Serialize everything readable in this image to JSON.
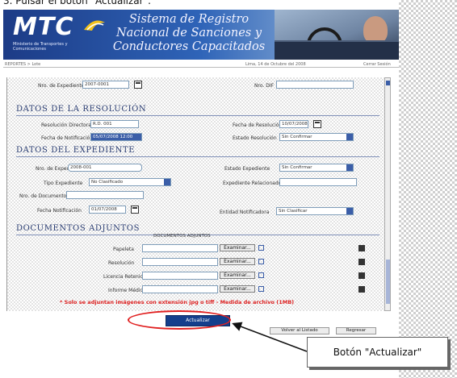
{
  "caption": "3. Pulsar el botón \"Actualizar\".",
  "banner": {
    "logo": "MTC",
    "logo_sub": "Ministerio de Transportes y Comunicaciones",
    "title_lines": [
      "Sistema de Registro",
      "Nacional de Sanciones y",
      "Conductores Capacitados"
    ]
  },
  "infobar": {
    "left": "REPORTES > Lote",
    "middle": "Lima, 14 de Octubre del 2008",
    "right": "Cerrar Sesión"
  },
  "top_row": {
    "fecha_label": "Nro. de Expediente",
    "fecha_value": "2007-0001",
    "ruc_label": "Nro. DIF",
    "ruc_value": ""
  },
  "resolucion": {
    "title": "DATOS DE LA RESOLUCIÓN",
    "nro_label": "Resolución Directoral",
    "nro_value": "R.D. 001",
    "fecha_label": "Fecha de Resolución",
    "fecha_value": "10/07/2008",
    "notif_label": "Fecha de Notificación",
    "notif_value": "05/07/2008 12:00",
    "estado_label": "Estado Resolución",
    "estado_value": "Sin Confirmar"
  },
  "expediente": {
    "title": "DATOS DEL EXPEDIENTE",
    "nro_label": "Nro. de Expediente",
    "nro_value": "2008-001",
    "estado_label": "Estado Expediente",
    "estado_value": "Sin Confirmar",
    "tipo_label": "Tipo Expediente",
    "tipo_value": "No Clasificado",
    "exp_label": "Expediente Relacionado",
    "exp_value": "",
    "doc_label": "Nro. de Documento Rel.",
    "doc_value": "",
    "fecha_label": "Fecha Notificación",
    "fecha_value": "01/07/2008",
    "entidad_label": "Entidad Notificadora",
    "entidad_value": "Sin Clasificar"
  },
  "documentos": {
    "title": "DOCUMENTOS ADJUNTOS",
    "subtitle": "DOCUMENTOS ADJUNTOS",
    "rows": [
      "Papeleta",
      "Resolución",
      "Licencia Retenida",
      "Informe Médico"
    ],
    "button_label": "Examinar..."
  },
  "notice": "* Solo se adjuntan imágenes con extensión jpg o tiff - Medida de archivo (1MB)",
  "buttons": {
    "actualizar": "Actualizar",
    "small_left": "Volver al Listado",
    "small_right": "Regresar"
  },
  "callout": "Botón \"Actualizar\"",
  "colors": {
    "accent": "#143f8c",
    "highlight": "#e02020",
    "notice": "#dd2222"
  }
}
